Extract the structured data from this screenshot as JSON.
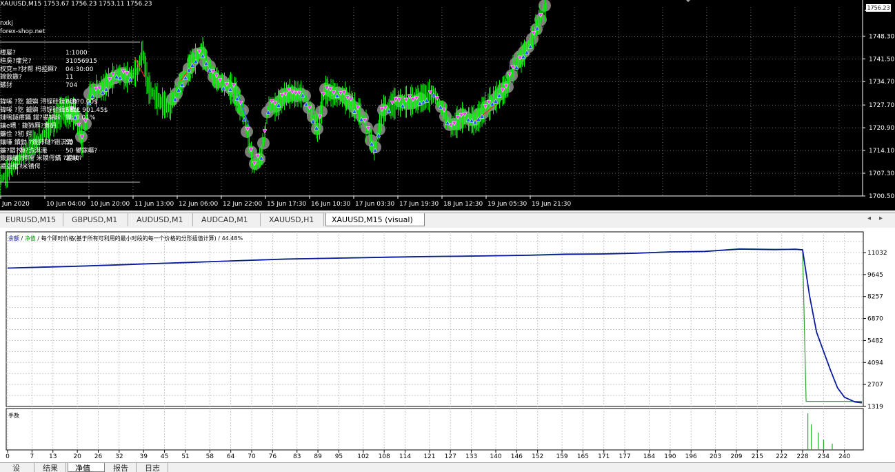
{
  "price_chart": {
    "header": "XAUUSD,M15  1753.67 1756.23 1753.11 1756.23",
    "ea_name": "nxkj",
    "ea_site": "forex-shop.net",
    "panel": [
      {
        "k": "楼屡?",
        "v": "1:1000"
      },
      {
        "k": "楦吳?癨兊?",
        "v": "31056915"
      },
      {
        "k": "杈兗=?犲帮    杩掗厤?",
        "v": "04:30:00"
      },
      {
        "k": "鍗敓鏃?",
        "v": "11"
      },
      {
        "k": "鏃犲",
        "v": "704"
      },
      {
        "k": "",
        "v": ""
      },
      {
        "k": "鍏嗘 ?犵  鐪嬩 浔锃硅鍓? 澶?",
        "v": "BUY 0.00$"
      },
      {
        "k": "鍏嗘 ?犵  鐪嬩 浔锃硅鍓? 绌?",
        "v": "SELL 901.45$"
      },
      {
        "k": "鏈嗚鐩瘎鏋 鍚?鍙婂紒",
        "v": "鏁: 0.01%"
      },
      {
        "k": "鑲e瓙 ' 鍑犻厤?寰砃",
        "v": ""
      },
      {
        "k": "鐮佺  ?牣   鍔",
        "v": ""
      },
      {
        "k": "鑲嗛 鐨勭 ?鍑犻鏈?铏淇濋",
        "v": "50"
      },
      {
        "k": "鐮?鍣?嫵?洈淇濈",
        "v": "50 鐢鎵嶇?"
      },
      {
        "k": "鍑鐮鑲?鍔嗗 米镄偔鏋 ?鍙栨?",
        "v": "2.00"
      },
      {
        "k": "鍙亞绾?米镄偔",
        "v": ""
      }
    ],
    "price_labels": [
      "1748.30",
      "1741.50",
      "1734.70",
      "1727.70",
      "1720.90",
      "1714.10",
      "1707.30",
      "1700.50"
    ],
    "current_price": "1756.23",
    "time_labels": [
      "Jun 2020",
      "10 Jun 04:00",
      "10 Jun 20:00",
      "11 Jun 13:00",
      "12 Jun 06:00",
      "12 Jun 22:00",
      "15 Jun 17:30",
      "16 Jun 10:30",
      "17 Jun 03:30",
      "17 Jun 19:30",
      "18 Jun 12:30",
      "19 Jun 05:30",
      "19 Jun 21:30"
    ]
  },
  "symbol_tabs": [
    {
      "label": "EURUSD,M15",
      "active": false
    },
    {
      "label": "GBPUSD,M1",
      "active": false
    },
    {
      "label": "AUDUSD,M1",
      "active": false
    },
    {
      "label": "AUDCAD,M1",
      "active": false
    },
    {
      "label": "XAUUSD,H1",
      "active": false
    },
    {
      "label": "XAUUSD,M15 (visual)",
      "active": true
    }
  ],
  "graph": {
    "legend_balance": "余额",
    "legend_sep": " / ",
    "legend_equity": "净值",
    "legend_rest": " / 每个即时价格(基于所有可利用的最小时段的每一个价格的分形插值计算) / 44.48%",
    "y_labels": [
      "11032",
      "9645",
      "8257",
      "6870",
      "5482",
      "4094",
      "2707",
      "1319"
    ],
    "x_labels": [
      "0",
      "7",
      "13",
      "20",
      "26",
      "32",
      "39",
      "45",
      "51",
      "58",
      "64",
      "70",
      "76",
      "83",
      "89",
      "95",
      "102",
      "108",
      "114",
      "121",
      "127",
      "133",
      "140",
      "146",
      "152",
      "159",
      "165",
      "171",
      "177",
      "184",
      "190",
      "196",
      "203",
      "209",
      "215",
      "222",
      "228",
      "234",
      "240"
    ],
    "lots_label": "手数",
    "colors": {
      "balance": "#0a1a9e",
      "equity": "#2ca02c",
      "grid": "#c8c8c8"
    }
  },
  "chart_data": {
    "type": "line",
    "title": "",
    "xlabel": "",
    "ylabel": "",
    "ylim": [
      1319,
      11032
    ],
    "xlim": [
      0,
      245
    ],
    "series": [
      {
        "name": "余额",
        "x": [
          0,
          10,
          20,
          30,
          40,
          50,
          60,
          70,
          80,
          90,
          100,
          110,
          120,
          130,
          140,
          150,
          160,
          170,
          180,
          190,
          200,
          210,
          220,
          226,
          228,
          230,
          232,
          234,
          236,
          238,
          240,
          243,
          245
        ],
        "y": [
          10050,
          10110,
          10170,
          10240,
          10320,
          10390,
          10470,
          10550,
          10620,
          10660,
          10700,
          10740,
          10780,
          10800,
          10830,
          10860,
          10920,
          10940,
          10990,
          11070,
          11100,
          11250,
          11220,
          11240,
          11200,
          8300,
          6000,
          4800,
          3600,
          2500,
          1900,
          1600,
          1550
        ]
      },
      {
        "name": "净值",
        "x": [
          0,
          10,
          20,
          30,
          40,
          50,
          60,
          70,
          80,
          90,
          100,
          110,
          120,
          130,
          140,
          150,
          160,
          170,
          180,
          190,
          200,
          210,
          220,
          226,
          228,
          229,
          232,
          236,
          240,
          245
        ],
        "y": [
          10060,
          10120,
          10180,
          10250,
          10330,
          10400,
          10480,
          10560,
          10640,
          10670,
          10720,
          10760,
          10790,
          10810,
          10840,
          10880,
          10950,
          10960,
          11000,
          11090,
          11120,
          11280,
          11240,
          11250,
          11200,
          1640,
          1640,
          1640,
          1640,
          1640
        ]
      }
    ]
  }
}
